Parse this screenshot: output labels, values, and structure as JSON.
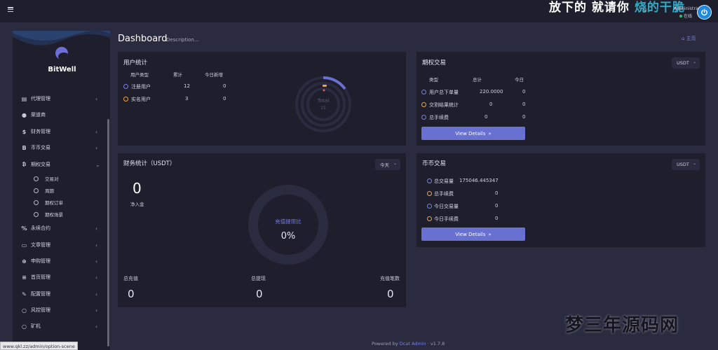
{
  "header": {
    "watermark_prefix": "放下的 就请你 ",
    "watermark_cyan": "烧的干脆",
    "admin_name": "Administrator",
    "online_label": "在线"
  },
  "sidebar": {
    "brand": "BitWell",
    "items": [
      {
        "label": "代理管理",
        "icon": "id-card-icon"
      },
      {
        "label": "渠道商",
        "icon": "user-circle-icon"
      },
      {
        "label": "财务管理",
        "icon": "dollar-icon"
      },
      {
        "label": "币币交易",
        "icon": "bitcoin-icon"
      },
      {
        "label": "期权交易",
        "icon": "bitcoin-icon"
      },
      {
        "label": "永续合约",
        "icon": "link-icon"
      },
      {
        "label": "文章管理",
        "icon": "newspaper-icon"
      },
      {
        "label": "申购管理",
        "icon": "globe-icon"
      },
      {
        "label": "首页管理",
        "icon": "list-icon"
      },
      {
        "label": "配置管理",
        "icon": "wrench-icon"
      },
      {
        "label": "风控管理",
        "icon": "circle-icon"
      },
      {
        "label": "矿机",
        "icon": "circle-icon"
      }
    ],
    "subitems": [
      "交易对",
      "周期",
      "期权订单",
      "期权场景"
    ],
    "url_tooltip": "www.qkl.zz/admin/option-scene"
  },
  "page": {
    "title": "Dashboard",
    "description": "Description...",
    "home_link": "主页"
  },
  "user_stats": {
    "title": "用户统计",
    "headers": [
      "用户类型",
      "累计",
      "今日新增"
    ],
    "rows": [
      {
        "type": "注册用户",
        "total": "12",
        "today": "0"
      },
      {
        "type": "实名用户",
        "total": "3",
        "today": "0"
      }
    ],
    "donut_label": "Total",
    "donut_value": "15"
  },
  "options_trading": {
    "title": "期权交易",
    "currency": "USDT",
    "headers": [
      "类型",
      "总计",
      "今日"
    ],
    "rows": [
      {
        "type": "用户总下单量",
        "total": "220.0000",
        "today": "0"
      },
      {
        "type": "交割结果统计",
        "total": "0",
        "today": "0"
      },
      {
        "type": "总手续费",
        "total": "0",
        "today": "0"
      }
    ],
    "button": "View Details"
  },
  "finance": {
    "title": "财务统计（USDT）",
    "period": "今天",
    "net_value": "0",
    "net_label": "净入金",
    "gauge_label": "充值提现比",
    "gauge_value": "0%",
    "footer": [
      {
        "label": "总充值",
        "value": "0"
      },
      {
        "label": "总提现",
        "value": "0"
      },
      {
        "label": "充值笔数",
        "value": "0"
      }
    ]
  },
  "spot_trading": {
    "title": "币币交易",
    "currency": "USDT",
    "rows": [
      {
        "label": "总交易量",
        "value": "175046.445347"
      },
      {
        "label": "总手续费",
        "value": "0"
      },
      {
        "label": "今日交易量",
        "value": "0"
      },
      {
        "label": "今日手续费",
        "value": "0"
      }
    ],
    "button": "View Details"
  },
  "footer": {
    "powered": "Powered by",
    "brand": "Dcat Admin",
    "version": "· v1.7.8"
  },
  "watermark_bottom": "梦三年源码网",
  "colors": {
    "accent": "#6870d2",
    "orange": "#f0a541",
    "online": "#29c47a",
    "power": "#1d8ae0"
  }
}
